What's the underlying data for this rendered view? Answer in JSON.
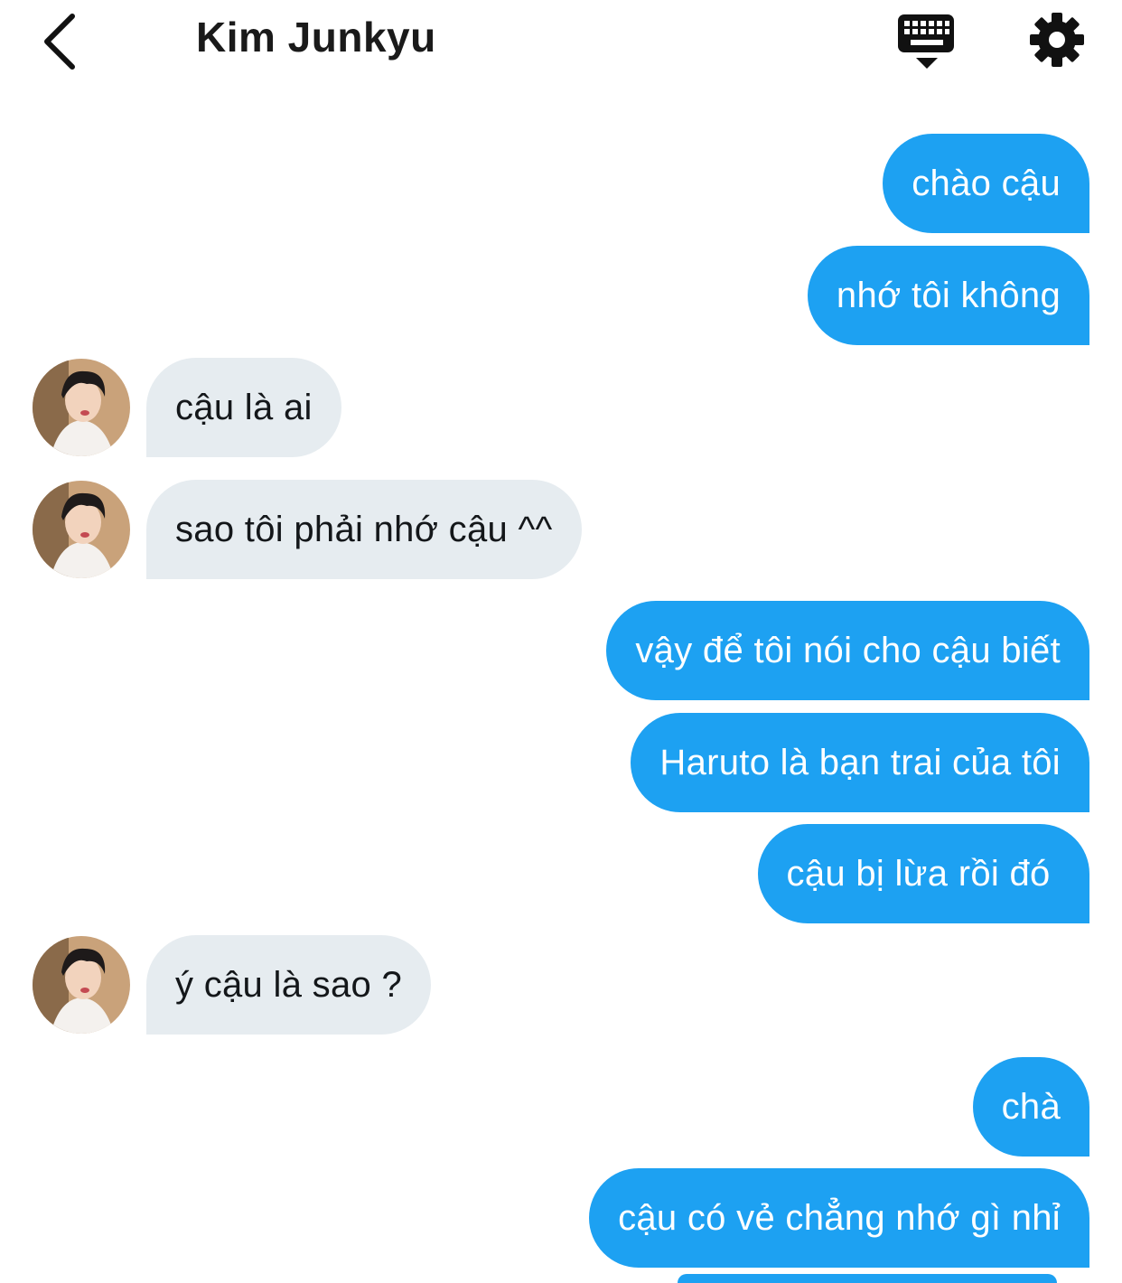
{
  "header": {
    "title": "Kim Junkyu",
    "back_icon": "chevron-left-icon",
    "keyboard_icon": "keyboard-hide-icon",
    "settings_icon": "gear-icon"
  },
  "colors": {
    "outgoing_bubble": "#1da1f2",
    "incoming_bubble": "#e6ecf0",
    "outgoing_text": "#ffffff",
    "incoming_text": "#14171a"
  },
  "messages": [
    {
      "side": "out",
      "text": "chào cậu"
    },
    {
      "side": "out",
      "text": "nhớ tôi không"
    },
    {
      "side": "in",
      "text": "cậu là ai"
    },
    {
      "side": "in",
      "text": "sao tôi phải nhớ cậu ^^"
    },
    {
      "side": "out",
      "text": "vậy để tôi nói cho cậu biết"
    },
    {
      "side": "out",
      "text": "Haruto là bạn trai của tôi"
    },
    {
      "side": "out",
      "text": "cậu bị lừa rồi đó "
    },
    {
      "side": "in",
      "text": "ý cậu là sao ?"
    },
    {
      "side": "out",
      "text": "chà"
    },
    {
      "side": "out",
      "text": "cậu có vẻ chẳng nhớ gì nhỉ"
    }
  ]
}
